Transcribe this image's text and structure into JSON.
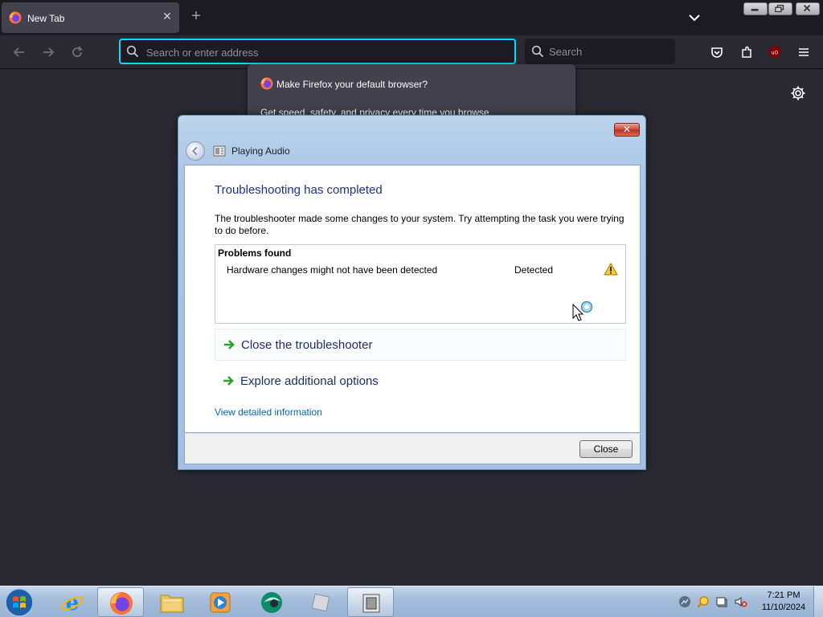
{
  "browser": {
    "tab_title": "New Tab",
    "url_placeholder": "Search or enter address",
    "search_placeholder": "Search",
    "default_prompt": {
      "heading": "Make Firefox your default browser?",
      "body": "Get speed, safety, and privacy every time you browse."
    }
  },
  "dialog": {
    "window_title": "Playing Audio",
    "heading": "Troubleshooting has completed",
    "description": "The troubleshooter made some changes to your system. Try attempting the task you were trying to do before.",
    "problems_header": "Problems found",
    "problems": [
      {
        "name": "Hardware changes might not have been detected",
        "status": "Detected",
        "icon": "warning-icon"
      }
    ],
    "links": {
      "close_troubleshooter": "Close the troubleshooter",
      "explore_options": "Explore additional options",
      "view_details": "View detailed information"
    },
    "close_button": "Close"
  },
  "taskbar": {
    "apps": [
      "internet-explorer",
      "firefox",
      "file-explorer",
      "media-player",
      "unknown-app",
      "unknown-app-2",
      "troubleshooter"
    ],
    "clock": {
      "time": "7:21 PM",
      "date": "11/10/2024"
    }
  },
  "colors": {
    "firefox_bg": "#2b2a33",
    "focus_ring": "#00ddff",
    "dialog_heading": "#1e3287",
    "link": "#0066cc",
    "taskbar": "#a5bdd9"
  }
}
